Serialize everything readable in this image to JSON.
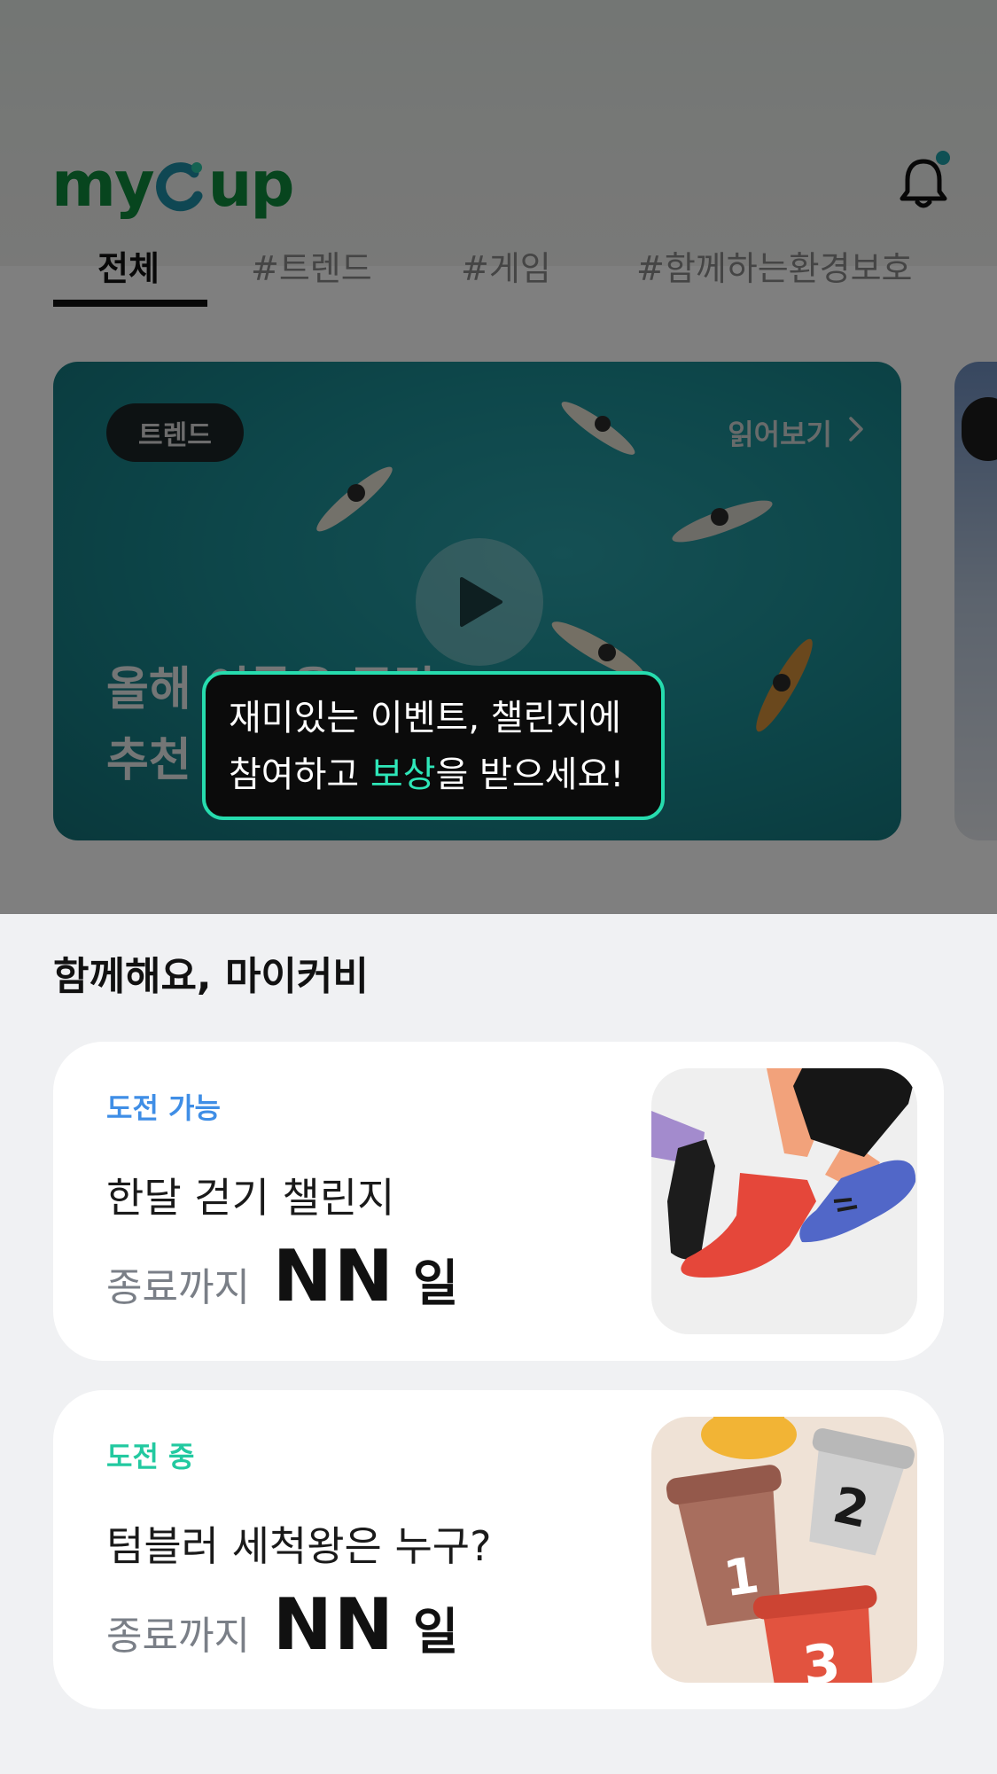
{
  "header": {
    "logo_text": "myCup",
    "brand_color": "#0f8a3c",
    "accent_color": "#1f8fa6",
    "notification_icon": "bell-icon"
  },
  "tabs": [
    {
      "label": "전체",
      "active": true
    },
    {
      "label": "#트렌드",
      "active": false
    },
    {
      "label": "#게임",
      "active": false
    },
    {
      "label": "#함께하는환경보호",
      "active": false
    }
  ],
  "featured": {
    "badge": "트렌드",
    "read_more": "읽어보기",
    "title_line1": "올해 여름을 즐길",
    "title_line2": "추천 여행지 BEST 10"
  },
  "tooltip": {
    "line1": "재미있는 이벤트, 챌린지에",
    "line2_pre": "참여하고 ",
    "line2_highlight": "보상",
    "line2_post": "을 받으세요!",
    "border_color": "#26dcae"
  },
  "section": {
    "title": "함께해요, 마이커비"
  },
  "challenges": [
    {
      "status": "도전 가능",
      "title": "한달 걷기 챌린지",
      "until_label": "종료까지",
      "days_value": "NN",
      "days_unit": "일",
      "thumbnail": "walking-feet-illustration"
    },
    {
      "status": "도전 중",
      "title": "텀블러 세척왕은 누구?",
      "until_label": "종료까지",
      "days_value": "NN",
      "days_unit": "일",
      "thumbnail": "numbered-cups-illustration",
      "cup_numbers": [
        "1",
        "2",
        "3"
      ]
    }
  ]
}
